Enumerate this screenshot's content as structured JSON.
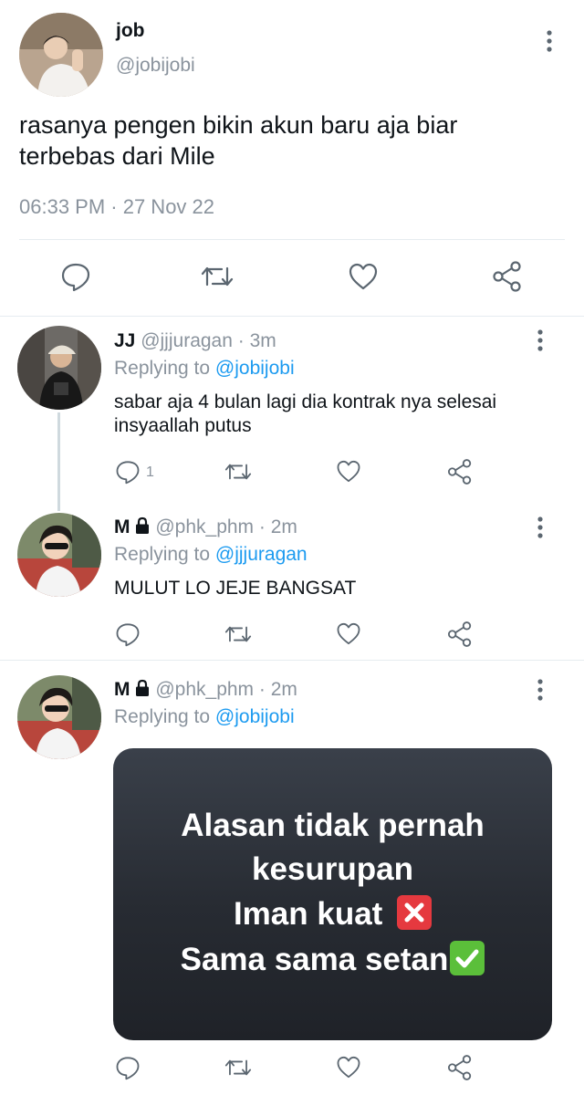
{
  "main_tweet": {
    "display_name": "job",
    "handle": "@jobijobi",
    "text_line1": "rasanya pengen bikin akun baru aja biar",
    "text_line2": "terbebas dari Mile",
    "timestamp": "06:33 PM · 27 Nov 22"
  },
  "replies": [
    {
      "display_name": "JJ",
      "handle": "@jjjuragan",
      "time": "· 3m",
      "replying_prefix": "Replying to",
      "replying_to": "@jobijobi",
      "text_line1": "sabar aja 4 bulan lagi dia kontrak nya selesai",
      "text_line2": "insyaallah putus",
      "reply_count": "1"
    },
    {
      "display_name": "M",
      "handle": "@phk_phm",
      "time": "· 2m",
      "replying_prefix": "Replying to",
      "replying_to": "@jjjuragan",
      "text_line1": "MULUT LO JEJE BANGSAT"
    },
    {
      "display_name": "M",
      "handle": "@phk_phm",
      "time": "· 2m",
      "replying_prefix": "Replying to",
      "replying_to": "@jobijobi",
      "media": {
        "line1": "Alasan tidak pernah",
        "line2": "kesurupan",
        "line3": "Iman kuat",
        "line4": "Sama sama setan",
        "emoji_cross": "❌",
        "emoji_check": "✅"
      }
    }
  ],
  "icons": [
    "more-icon",
    "reply-icon",
    "retweet-icon",
    "like-icon",
    "share-icon",
    "lock-icon"
  ],
  "colors": {
    "link": "#1d9bf0",
    "secondary_text": "#8a939d",
    "icon": "#5b6670",
    "divider": "#e6ecf0",
    "media_bg": "#2b3038"
  }
}
